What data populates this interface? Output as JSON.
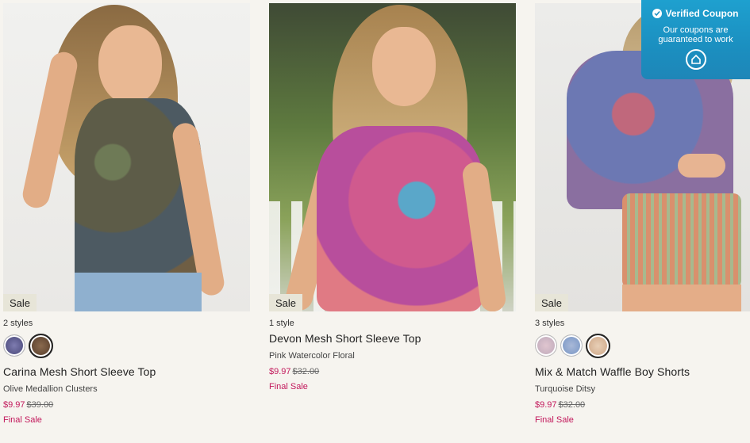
{
  "products": [
    {
      "badge": "Sale",
      "styles_count": "2 styles",
      "swatches": [
        {
          "color": "#5b5a8a",
          "selected": false
        },
        {
          "color": "#6b4a36",
          "selected": true
        }
      ],
      "name": "Carina Mesh Short Sleeve Top",
      "color_name": "Olive Medallion Clusters",
      "price_now": "$9.97",
      "price_was": "$39.00",
      "final": "Final Sale"
    },
    {
      "badge": "Sale",
      "styles_count": "1 style",
      "swatches": [],
      "name": "Devon Mesh Short Sleeve Top",
      "color_name": "Pink Watercolor Floral",
      "price_now": "$9.97",
      "price_was": "$32.00",
      "final": "Final Sale"
    },
    {
      "badge": "Sale",
      "styles_count": "3 styles",
      "swatches": [
        {
          "color": "#d8b8c4",
          "selected": false
        },
        {
          "color": "#7f9bc4",
          "selected": false
        },
        {
          "color": "#d9b89a",
          "selected": true
        }
      ],
      "name": "Mix & Match Waffle Boy Shorts",
      "color_name": "Turquoise Ditsy",
      "price_now": "$9.97",
      "price_was": "$32.00",
      "final": "Final Sale"
    }
  ],
  "coupon": {
    "title": "Verified Coupon",
    "subtitle_line1": "Our coupons are",
    "subtitle_line2": "guaranteed to work",
    "icon": "coupon-logo-icon"
  }
}
